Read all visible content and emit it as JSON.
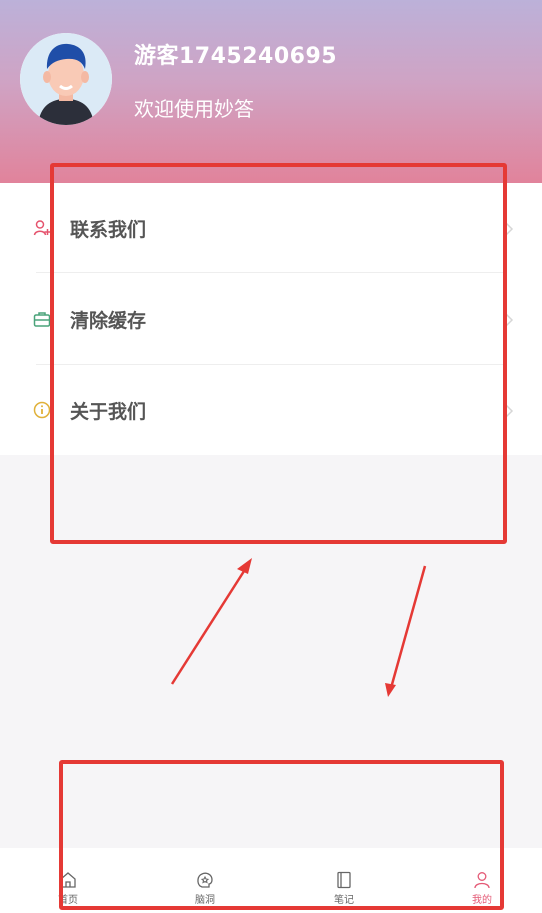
{
  "profile": {
    "username": "游客1745240695",
    "welcome": "欢迎使用妙答",
    "avatar_icon": "user-avatar"
  },
  "menu": {
    "items": [
      {
        "label": "联系我们",
        "icon": "contact-icon",
        "icon_color": "#e5536d"
      },
      {
        "label": "清除缓存",
        "icon": "toolbox-icon",
        "icon_color": "#4aa37a"
      },
      {
        "label": "关于我们",
        "icon": "info-icon",
        "icon_color": "#e0b13a"
      }
    ]
  },
  "tabbar": {
    "items": [
      {
        "label": "首页",
        "icon": "home-icon"
      },
      {
        "label": "脑洞",
        "icon": "brain-icon"
      },
      {
        "label": "笔记",
        "icon": "book-icon"
      },
      {
        "label": "我的",
        "icon": "person-icon",
        "active": true
      }
    ]
  },
  "colors": {
    "header_gradient_top": "#bcb1d9",
    "header_gradient_bottom": "#e1839b",
    "accent": "#e45a76",
    "annotation": "#e53935"
  }
}
